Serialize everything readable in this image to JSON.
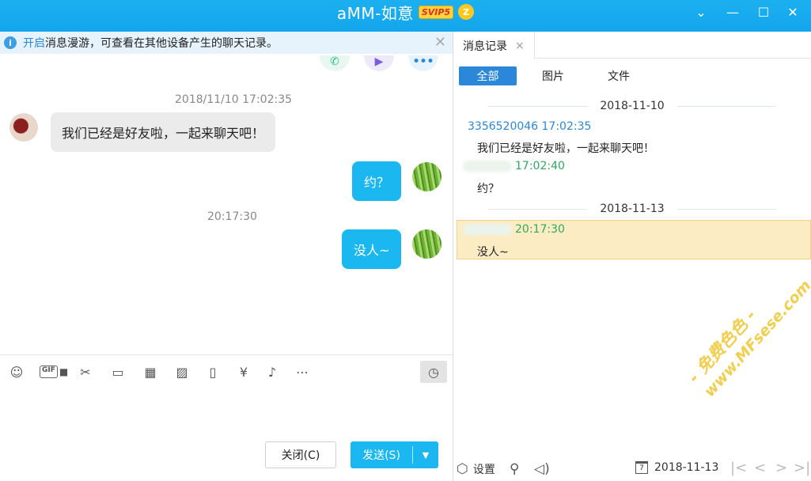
{
  "window": {
    "title": "aMM-如意",
    "badge": "SVIP5",
    "crown_glyph": "Z",
    "minimize": "—",
    "maximize": "☐",
    "close": "✕",
    "dropdown": "⌄"
  },
  "notice": {
    "info": "i",
    "link": "开启",
    "text": "消息漫游，可查看在其他设备产生的聊天记录。",
    "close": "✕"
  },
  "call": {
    "phone": "✆",
    "video": "▶",
    "more": "•••"
  },
  "chat": {
    "time1": "2018/11/10 17:02:35",
    "msg_in": "我们已经是好友啦，一起来聊天吧！",
    "msg_out1": "约？",
    "time2": "20:17:30",
    "msg_out2": "没人~"
  },
  "toolbar": {
    "emoji": "☺",
    "gif": "GIF",
    "cut": "✂",
    "folder": "▭",
    "doc": "▦",
    "image": "▨",
    "shake": "▯",
    "redpacket": "¥",
    "music": "♪",
    "more": "⋯",
    "history": "◷"
  },
  "buttons": {
    "close": "关闭(C)",
    "send": "发送(S)",
    "send_arrow": "▼"
  },
  "history": {
    "tab": "消息记录",
    "tab_close": "×",
    "filters": [
      "全部",
      "图片",
      "文件"
    ],
    "date1": "2018-11-10",
    "entry1_meta": "3356520046 17:02:35",
    "entry1_text": "我们已经是好友啦，一起来聊天吧！",
    "entry2_time": "17:02:40",
    "entry2_text": "约？",
    "date2": "2018-11-13",
    "entry3_time": "20:17:30",
    "entry3_text": "没人~"
  },
  "history_bottom": {
    "settings_icon": "⬡",
    "settings": "设置",
    "search_icon": "⚲",
    "voice_icon": "◁)",
    "cal_icon": "7",
    "date": "2018-11-13",
    "first": "|<",
    "prev": "<",
    "next": ">",
    "last": ">|"
  },
  "watermark": {
    "line1": "- 免费色色 -",
    "line2": "www.MFsese.com"
  }
}
